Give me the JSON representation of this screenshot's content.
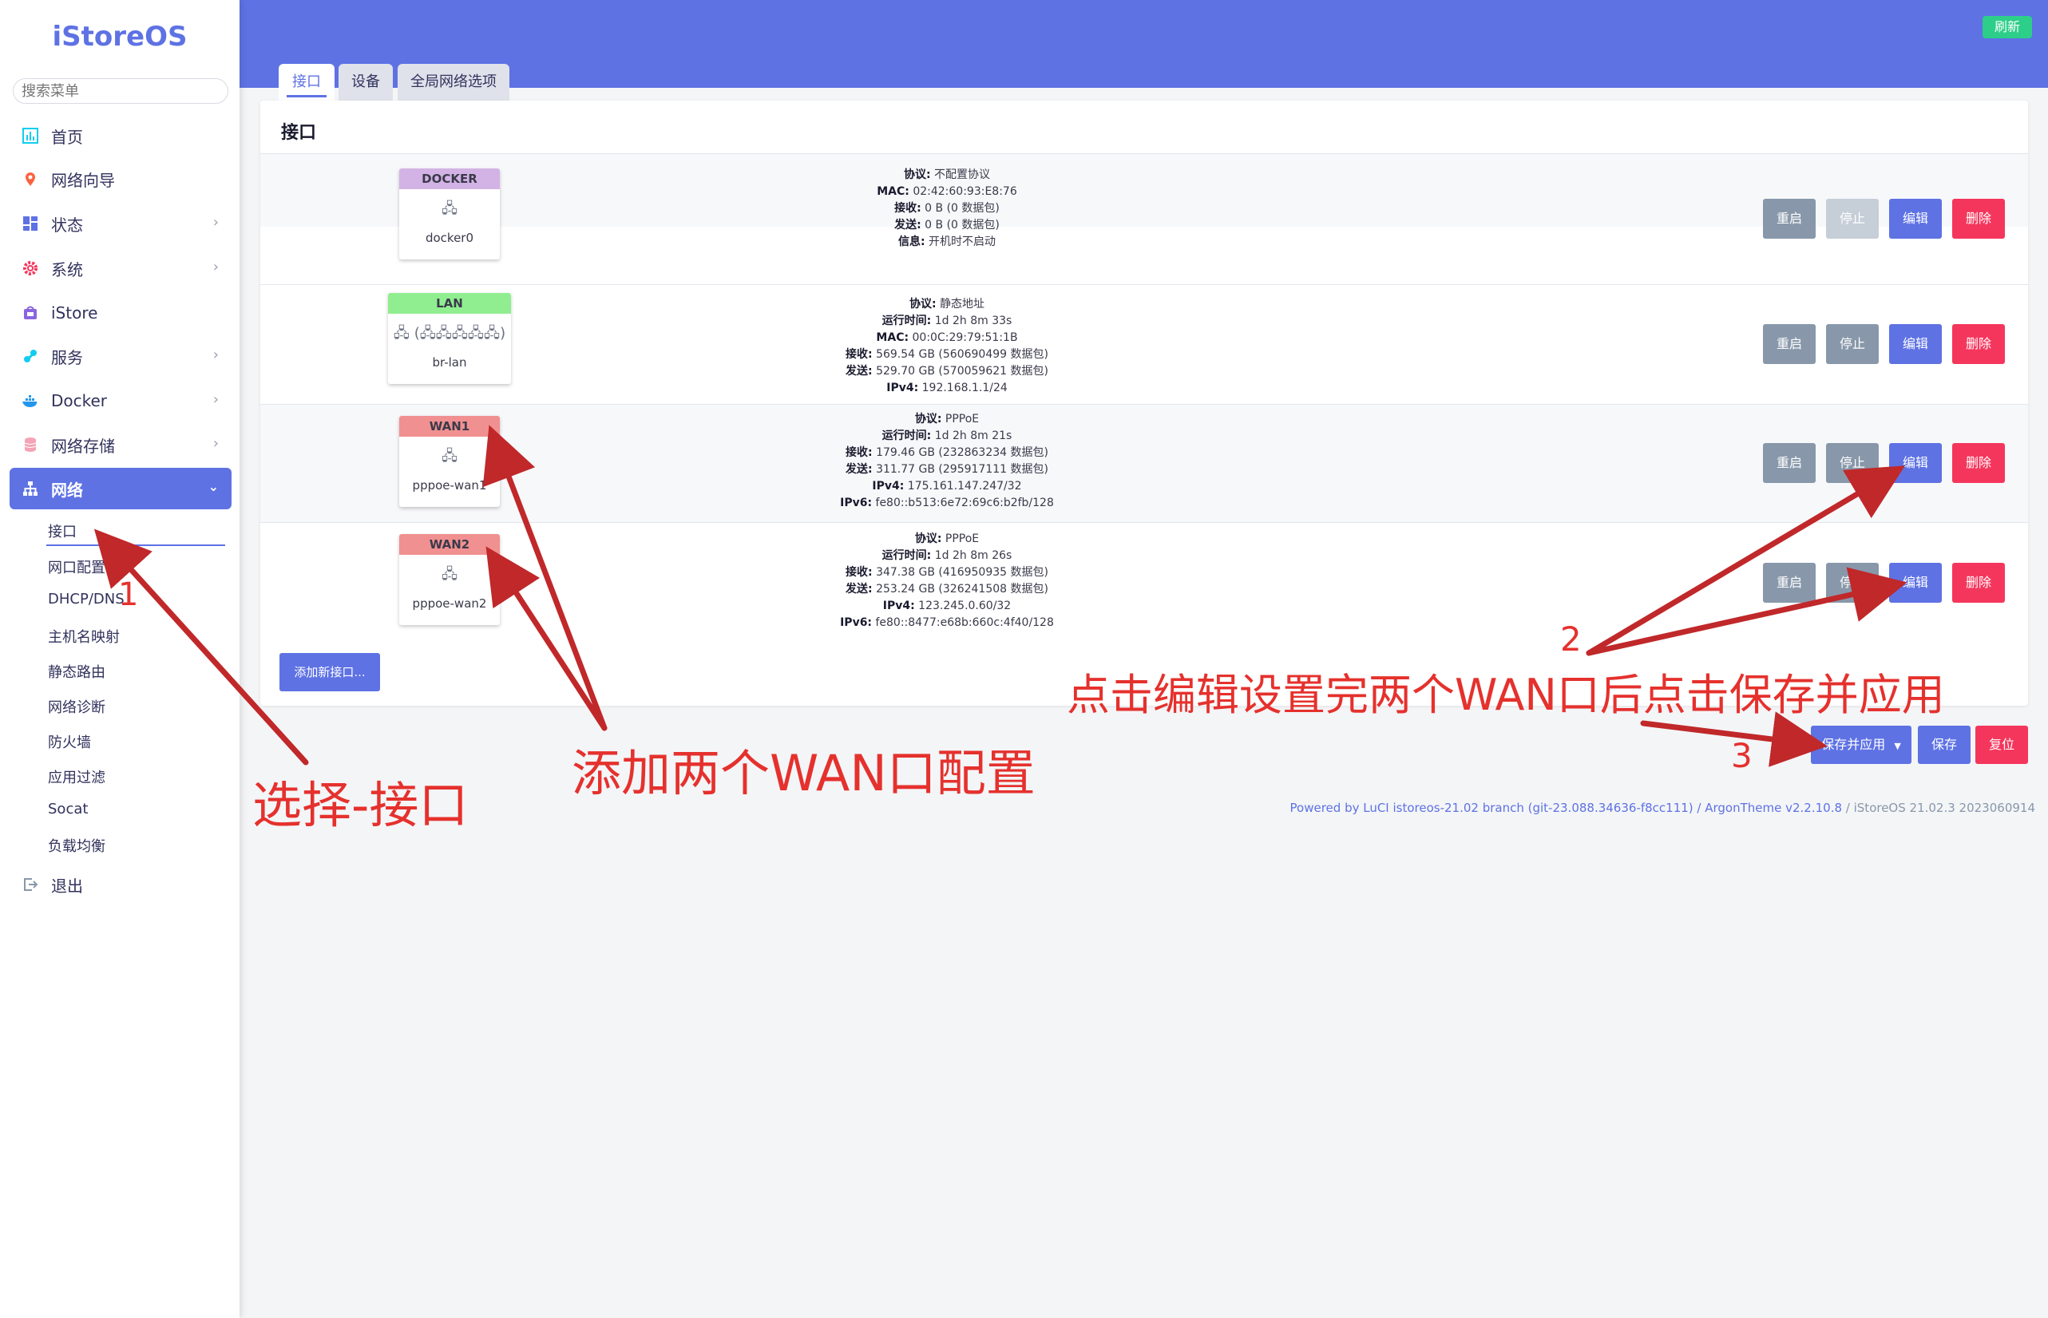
{
  "app": {
    "logo": "iStoreOS",
    "search_placeholder": "搜索菜单"
  },
  "sidebar": {
    "items": [
      {
        "label": "首页",
        "icon": "chart-icon",
        "has_chevron": false
      },
      {
        "label": "网络向导",
        "icon": "map-pin-icon",
        "has_chevron": false
      },
      {
        "label": "状态",
        "icon": "dashboard-icon",
        "has_chevron": true
      },
      {
        "label": "系统",
        "icon": "gear-icon",
        "has_chevron": true
      },
      {
        "label": "iStore",
        "icon": "store-icon",
        "has_chevron": false
      },
      {
        "label": "服务",
        "icon": "puzzle-icon",
        "has_chevron": true
      },
      {
        "label": "Docker",
        "icon": "docker-icon",
        "has_chevron": true
      },
      {
        "label": "网络存储",
        "icon": "database-icon",
        "has_chevron": true
      },
      {
        "label": "网络",
        "icon": "network-icon",
        "has_chevron": true,
        "active": true
      },
      {
        "label": "退出",
        "icon": "logout-icon",
        "has_chevron": false
      }
    ],
    "subitems": [
      "接口",
      "网口配置",
      "DHCP/DNS",
      "主机名映射",
      "静态路由",
      "网络诊断",
      "防火墙",
      "应用过滤",
      "Socat",
      "负载均衡"
    ]
  },
  "header": {
    "refresh_label": "刷新"
  },
  "tabs": [
    {
      "label": "接口",
      "active": true
    },
    {
      "label": "设备"
    },
    {
      "label": "全局网络选项"
    }
  ],
  "card": {
    "title": "接口"
  },
  "interfaces": [
    {
      "name": "DOCKER",
      "color": "#d3b3e5",
      "device": "docker0",
      "icon_text": "🖧",
      "info": [
        [
          "协议:",
          "不配置协议"
        ],
        [
          "MAC:",
          "02:42:60:93:E8:76"
        ],
        [
          "接收:",
          "0 B (0 数据包)"
        ],
        [
          "发送:",
          "0 B (0 数据包)"
        ],
        [
          "信息:",
          "开机时不启动"
        ]
      ],
      "stop_disabled": true
    },
    {
      "name": "LAN",
      "color": "#90ee90",
      "device": "br-lan",
      "icon_text": "🖧 (🖧🖧🖧🖧🖧)",
      "info": [
        [
          "协议:",
          "静态地址"
        ],
        [
          "运行时间:",
          "1d 2h 8m 33s"
        ],
        [
          "MAC:",
          "00:0C:29:79:51:1B"
        ],
        [
          "接收:",
          "569.54 GB (560690499 数据包)"
        ],
        [
          "发送:",
          "529.70 GB (570059621 数据包)"
        ],
        [
          "IPv4:",
          "192.168.1.1/24"
        ]
      ]
    },
    {
      "name": "WAN1",
      "color": "#f09090",
      "device": "pppoe-wan1",
      "icon_text": "🖧",
      "info": [
        [
          "协议:",
          "PPPoE"
        ],
        [
          "运行时间:",
          "1d 2h 8m 21s"
        ],
        [
          "接收:",
          "179.46 GB (232863234 数据包)"
        ],
        [
          "发送:",
          "311.77 GB (295917111 数据包)"
        ],
        [
          "IPv4:",
          "175.161.147.247/32"
        ],
        [
          "IPv6:",
          "fe80::b513:6e72:69c6:b2fb/128"
        ]
      ]
    },
    {
      "name": "WAN2",
      "color": "#f09090",
      "device": "pppoe-wan2",
      "icon_text": "🖧",
      "info": [
        [
          "协议:",
          "PPPoE"
        ],
        [
          "运行时间:",
          "1d 2h 8m 26s"
        ],
        [
          "接收:",
          "347.38 GB (416950935 数据包)"
        ],
        [
          "发送:",
          "253.24 GB (326241508 数据包)"
        ],
        [
          "IPv4:",
          "123.245.0.60/32"
        ],
        [
          "IPv6:",
          "fe80::8477:e68b:660c:4f40/128"
        ]
      ]
    }
  ],
  "row_actions": {
    "restart": "重启",
    "stop": "停止",
    "edit": "编辑",
    "delete": "删除"
  },
  "add_interface_label": "添加新接口...",
  "bottom": {
    "save_apply": "保存并应用",
    "save": "保存",
    "reset": "复位"
  },
  "footer": {
    "powered": "Powered by LuCI istoreos-21.02 branch (git-23.088.34636-f8cc111) / ArgonTheme v2.2.10.8",
    "version": " / iStoreOS 21.02.3 2023060914"
  },
  "annotations": {
    "select": "选择-接口",
    "add_wan": "添加两个WAN口配置",
    "instruction": "点击编辑设置完两个WAN口后点击保存并应用",
    "n1": "1",
    "n2": "2",
    "n3": "3",
    "color": "#e5312d"
  }
}
